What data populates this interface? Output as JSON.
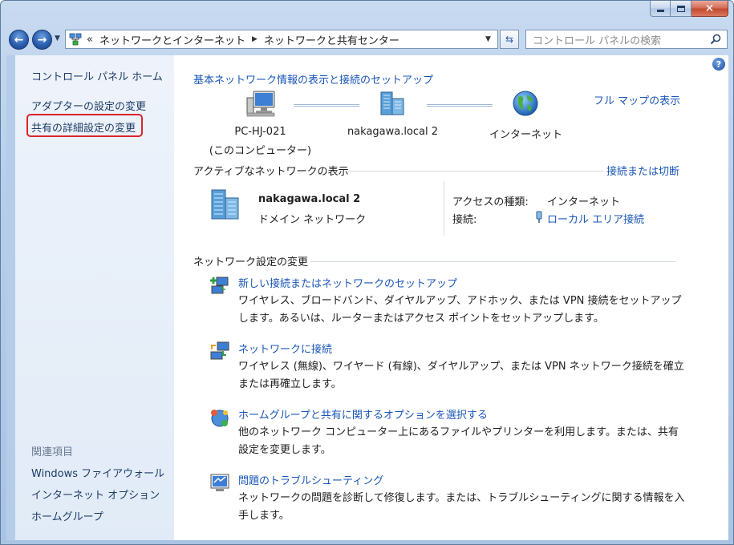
{
  "address": {
    "crumbs": [
      "«",
      "ネットワークとインターネット",
      "ネットワークと共有センター"
    ],
    "search_placeholder": "コントロール パネルの検索"
  },
  "sidebar": {
    "home": "コントロール パネル ホーム",
    "adapter": "アダプターの設定の変更",
    "sharing": "共有の詳細設定の変更",
    "related_heading": "関連項目",
    "related": [
      "Windows ファイアウォール",
      "インターネット オプション",
      "ホームグループ"
    ]
  },
  "main": {
    "title": "基本ネットワーク情報の表示と接続のセットアップ",
    "full_map": "フル マップの表示",
    "map": {
      "computer_name": "PC-HJ-021",
      "computer_sub": "(このコンピューター)",
      "network": "nakagawa.local  2",
      "internet": "インターネット"
    },
    "active": {
      "heading": "アクティブなネットワークの表示",
      "connect_link": "接続または切断",
      "name": "nakagawa.local  2",
      "type": "ドメイン ネットワーク",
      "access_label": "アクセスの種類:",
      "access_value": "インターネット",
      "conn_label": "接続:",
      "conn_value": "ローカル エリア接続"
    },
    "change": {
      "heading": "ネットワーク設定の変更",
      "tasks": [
        {
          "title": "新しい接続またはネットワークのセットアップ",
          "desc": "ワイヤレス、ブロードバンド、ダイヤルアップ、アドホック、または VPN 接続をセットアップします。あるいは、ルーターまたはアクセス ポイントをセットアップします。"
        },
        {
          "title": "ネットワークに接続",
          "desc": "ワイヤレス (無線)、ワイヤード (有線)、ダイヤルアップ、または VPN ネットワーク接続を確立または再確立します。"
        },
        {
          "title": "ホームグループと共有に関するオプションを選択する",
          "desc": "他のネットワーク コンピューター上にあるファイルやプリンターを利用します。または、共有設定を変更します。"
        },
        {
          "title": "問題のトラブルシューティング",
          "desc": "ネットワークの問題を診断して修復します。または、トラブルシューティングに関する情報を入手します。"
        }
      ]
    }
  }
}
